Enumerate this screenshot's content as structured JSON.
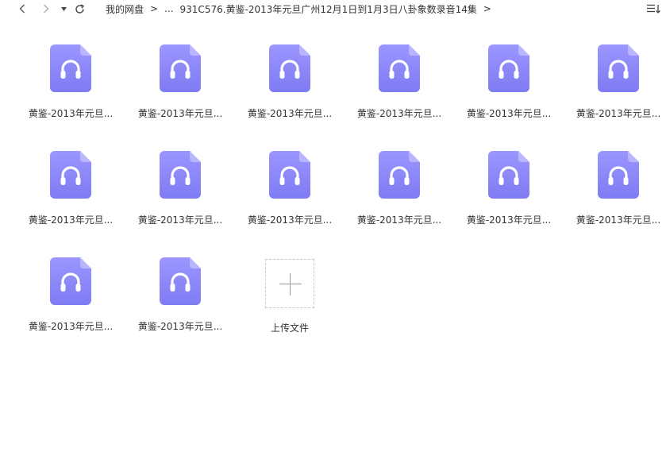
{
  "breadcrumb": {
    "root": "我的网盘",
    "separator": ">",
    "ellipsis": "...",
    "current": "931C576.黄鉴-2013年元旦广州12月1日到1月3日八卦象数录音14集"
  },
  "files": [
    {
      "name": "黄鉴-2013年元旦..."
    },
    {
      "name": "黄鉴-2013年元旦..."
    },
    {
      "name": "黄鉴-2013年元旦..."
    },
    {
      "name": "黄鉴-2013年元旦..."
    },
    {
      "name": "黄鉴-2013年元旦..."
    },
    {
      "name": "黄鉴-2013年元旦..."
    },
    {
      "name": "黄鉴-2013年元旦..."
    },
    {
      "name": "黄鉴-2013年元旦..."
    },
    {
      "name": "黄鉴-2013年元旦..."
    },
    {
      "name": "黄鉴-2013年元旦..."
    },
    {
      "name": "黄鉴-2013年元旦..."
    },
    {
      "name": "黄鉴-2013年元旦..."
    },
    {
      "name": "黄鉴-2013年元旦..."
    },
    {
      "name": "黄鉴-2013年元旦..."
    }
  ],
  "upload": {
    "label": "上传文件"
  },
  "colors": {
    "audio_icon_top": "#9b96ff",
    "audio_icon_bottom": "#7f7bf2",
    "audio_icon_fold": "#b9b5ff"
  },
  "icons": {
    "back": "chevron-left-icon",
    "forward": "chevron-right-icon",
    "history": "caret-down-icon",
    "refresh": "refresh-icon",
    "sort": "sort-icon",
    "file": "headphones-icon",
    "upload": "plus-icon"
  }
}
